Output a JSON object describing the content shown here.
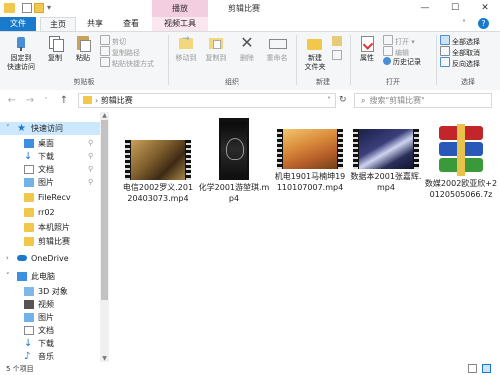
{
  "window": {
    "title": "剪辑比赛",
    "contextual_group": "播放",
    "controls": [
      "—",
      "☐",
      "✕"
    ]
  },
  "tabs": {
    "file": "文件",
    "home": "主页",
    "share": "共享",
    "view": "查看",
    "video_tools": "视频工具"
  },
  "ribbon": {
    "clipboard": {
      "label": "剪贴板",
      "pin": [
        "固定到",
        "快速访问"
      ],
      "copy": "复制",
      "paste": "粘贴",
      "cut": "剪切",
      "copy_path": "复制路径",
      "paste_shortcut": "粘贴快捷方式"
    },
    "organize": {
      "label": "组织",
      "move_to": "移动到",
      "copy_to": "复制到",
      "delete": "删除",
      "rename": "重命名"
    },
    "new": {
      "label": "新建",
      "new_folder": [
        "新建",
        "文件夹"
      ]
    },
    "open": {
      "label": "打开",
      "properties": "属性",
      "open": "打开",
      "edit": "编辑",
      "history": "历史记录"
    },
    "select": {
      "label": "选择",
      "select_all": "全部选择",
      "select_none": "全部取消",
      "invert": "反向选择"
    }
  },
  "address": {
    "path": "剪辑比赛",
    "search_placeholder": "搜索\"剪辑比赛\""
  },
  "sidebar": {
    "quick_access": "快速访问",
    "items": [
      {
        "label": "桌面",
        "pinned": true
      },
      {
        "label": "下载",
        "pinned": true
      },
      {
        "label": "文档",
        "pinned": true
      },
      {
        "label": "图片",
        "pinned": true
      },
      {
        "label": "FileRecv",
        "pinned": false
      },
      {
        "label": "rr02",
        "pinned": false
      },
      {
        "label": "本机照片",
        "pinned": false
      },
      {
        "label": "剪辑比赛",
        "pinned": false
      }
    ],
    "onedrive": "OneDrive",
    "this_pc": "此电脑",
    "pc_items": [
      "3D 对象",
      "视频",
      "图片",
      "文档",
      "下载",
      "音乐"
    ]
  },
  "files": [
    {
      "name": "电信2002罗义.20120403073.mp4"
    },
    {
      "name": "化学2001游堃琪.mp4"
    },
    {
      "name": "机电1901马楠坤19110107007.mp4"
    },
    {
      "name": "数据本2001张嘉辉.mp4"
    },
    {
      "name": "数媒2002欧亚欣+20120505066.7z"
    }
  ],
  "status": {
    "count": "5 个项目"
  },
  "colors": {
    "accent": "#1979ca",
    "contextual_tab": "#f3cde0",
    "folder": "#f1c84b"
  }
}
